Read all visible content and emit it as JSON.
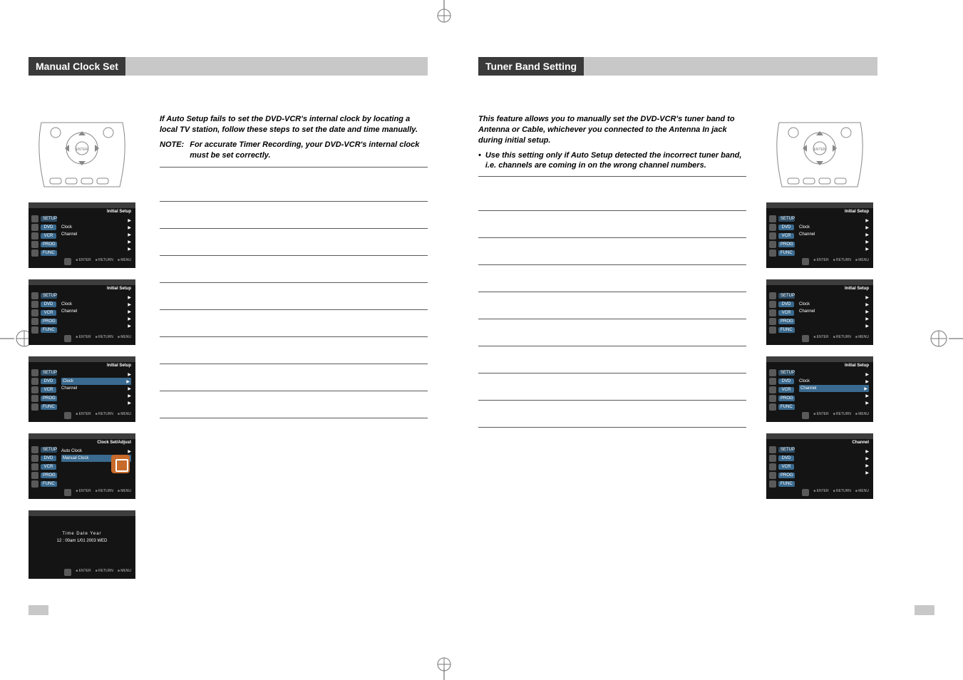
{
  "left": {
    "title": "Manual Clock Set",
    "intro": "If Auto Setup fails to set the DVD-VCR's internal clock by locating a local TV station, follow these steps to set the date and time manually.",
    "note_label": "NOTE:",
    "note_body": "For accurate Timer Recording, your DVD-VCR's internal clock must be set correctly.",
    "osd_common": {
      "title": "Initial Setup",
      "nav": [
        "SETUP",
        "DVD",
        "VCR",
        "PROG",
        "FUNC"
      ],
      "content_rows": [
        "Clock",
        "Channel"
      ],
      "bottom": [
        "ENTER",
        "RETURN",
        "MENU"
      ]
    },
    "osd_clock_adjust": {
      "title": "Clock Set/Adjust",
      "rows": [
        "Auto Clock",
        "Manual Clock"
      ]
    },
    "osd_manual_clock": {
      "header": "Time   Date   Year",
      "value": "12 : 00am  1/01   2003   WED"
    }
  },
  "right": {
    "title": "Tuner Band Setting",
    "intro": "This feature allows you to manually set the DVD-VCR's tuner band to Antenna or Cable, whichever you connected to the Antenna In jack during initial setup.",
    "bullet": "Use this setting only if Auto Setup detected the incorrect tuner band, i.e. channels are coming in on the wrong channel numbers.",
    "osd_common": {
      "title": "Initial Setup",
      "nav": [
        "SETUP",
        "DVD",
        "VCR",
        "PROG",
        "FUNC"
      ],
      "content_rows": [
        "Clock",
        "Channel"
      ],
      "bottom": [
        "ENTER",
        "RETURN",
        "MENU"
      ]
    },
    "osd_channel": {
      "title": "Channel"
    }
  },
  "arrow": "▶"
}
